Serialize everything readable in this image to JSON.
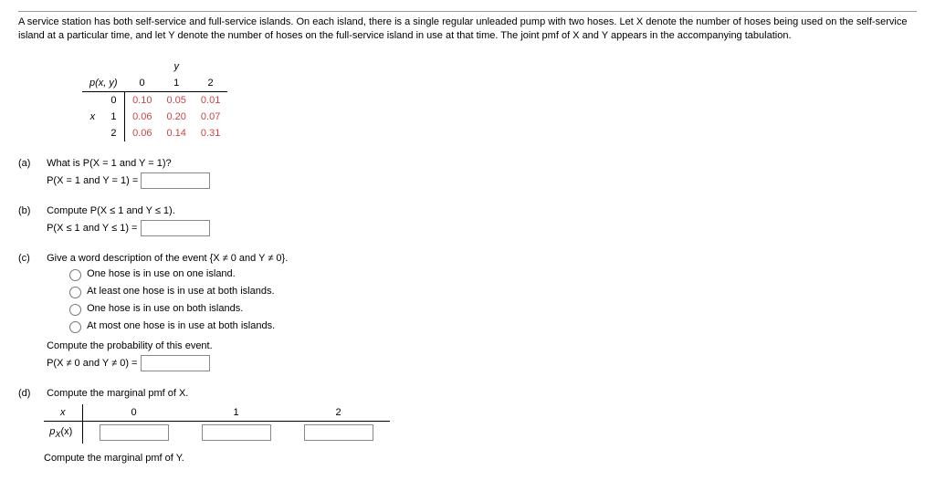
{
  "intro": "A service station has both self-service and full-service islands. On each island, there is a single regular unleaded pump with two hoses. Let X denote the number of hoses being used on the self-service island at a particular time, and let Y denote the number of hoses on the full-service island in use at that time. The joint pmf of X and Y appears in the accompanying tabulation.",
  "pmf": {
    "corner": "p(x, y)",
    "ylabel": "y",
    "xlabel": "x",
    "cols": [
      "0",
      "1",
      "2"
    ],
    "rows": [
      "0",
      "1",
      "2"
    ],
    "data": [
      [
        "0.10",
        "0.05",
        "0.01"
      ],
      [
        "0.06",
        "0.20",
        "0.07"
      ],
      [
        "0.06",
        "0.14",
        "0.31"
      ]
    ]
  },
  "parts": {
    "a": {
      "label": "(a)",
      "q": "What is P(X = 1 and Y = 1)?",
      "ans_label": "P(X = 1 and Y = 1) ="
    },
    "b": {
      "label": "(b)",
      "q": "Compute P(X ≤ 1 and Y ≤ 1).",
      "ans_label": "P(X ≤ 1 and Y ≤ 1) ="
    },
    "c": {
      "label": "(c)",
      "q": "Give a word description of the event {X ≠ 0 and Y ≠ 0}.",
      "options": [
        "One hose is in use on one island.",
        "At least one hose is in use at both islands.",
        "One hose is in use on both islands.",
        "At most one hose is in use at both islands."
      ],
      "followup": "Compute the probability of this event.",
      "ans_label": "P(X ≠ 0 and Y ≠ 0) ="
    },
    "d": {
      "label": "(d)",
      "q": "Compute the marginal pmf of X.",
      "xhead": "x",
      "xrow_lbl": "p",
      "xrow_sub": "X",
      "xrow_arg": "(x)",
      "cols": [
        "0",
        "1",
        "2"
      ],
      "followup": "Compute the marginal pmf of Y."
    }
  }
}
